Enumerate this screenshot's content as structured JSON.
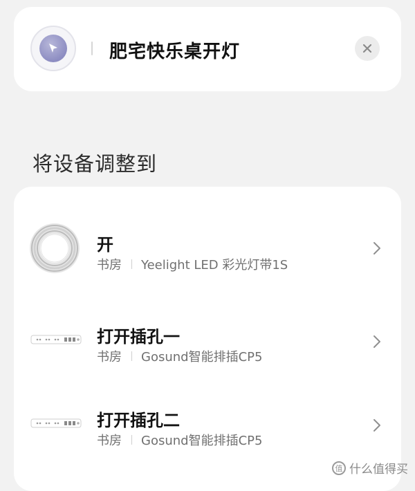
{
  "scene": {
    "title": "肥宅快乐桌开灯",
    "icon": "cursor-arrow-icon",
    "close_icon": "close-icon"
  },
  "section": {
    "heading": "将设备调整到"
  },
  "devices": [
    {
      "action": "开",
      "room": "书房",
      "device": "Yeelight LED 彩光灯带1S",
      "icon": "led-strip-icon"
    },
    {
      "action": "打开插孔一",
      "room": "书房",
      "device": "Gosund智能排插CP5",
      "icon": "power-strip-icon"
    },
    {
      "action": "打开插孔二",
      "room": "书房",
      "device": "Gosund智能排插CP5",
      "icon": "power-strip-icon"
    }
  ],
  "watermark": {
    "badge": "值",
    "text": "什么值得买"
  },
  "colors": {
    "background": "#f2f2f2",
    "card": "#ffffff",
    "icon_accent": "#8d8dc2"
  }
}
